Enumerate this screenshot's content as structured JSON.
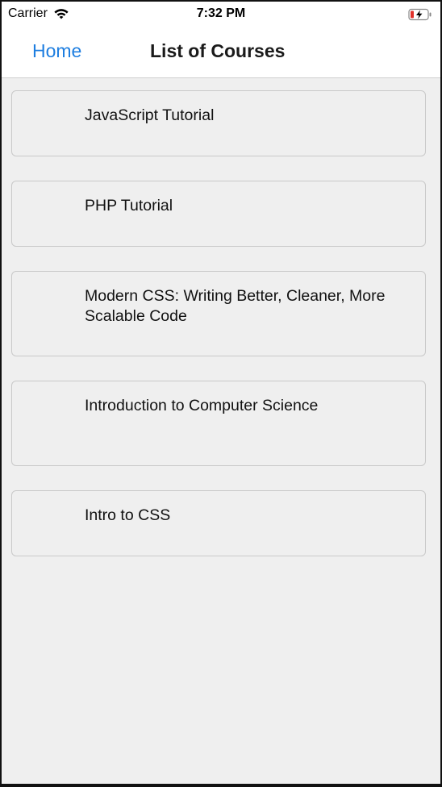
{
  "status_bar": {
    "carrier": "Carrier",
    "time": "7:32 PM",
    "wifi_icon": "wifi-icon",
    "battery_icon": "battery-charging-icon"
  },
  "nav": {
    "back_label": "Home",
    "title": "List of Courses"
  },
  "courses": [
    {
      "title": "JavaScript Tutorial"
    },
    {
      "title": "PHP Tutorial"
    },
    {
      "title": "Modern CSS: Writing Better, Cleaner, More Scalable Code"
    },
    {
      "title": "Introduction to Computer Science"
    },
    {
      "title": "Intro to CSS"
    }
  ],
  "colors": {
    "accent": "#1e7ee0",
    "background": "#efefef",
    "card_border": "#c9c9c9",
    "battery_low": "#e0302a"
  }
}
